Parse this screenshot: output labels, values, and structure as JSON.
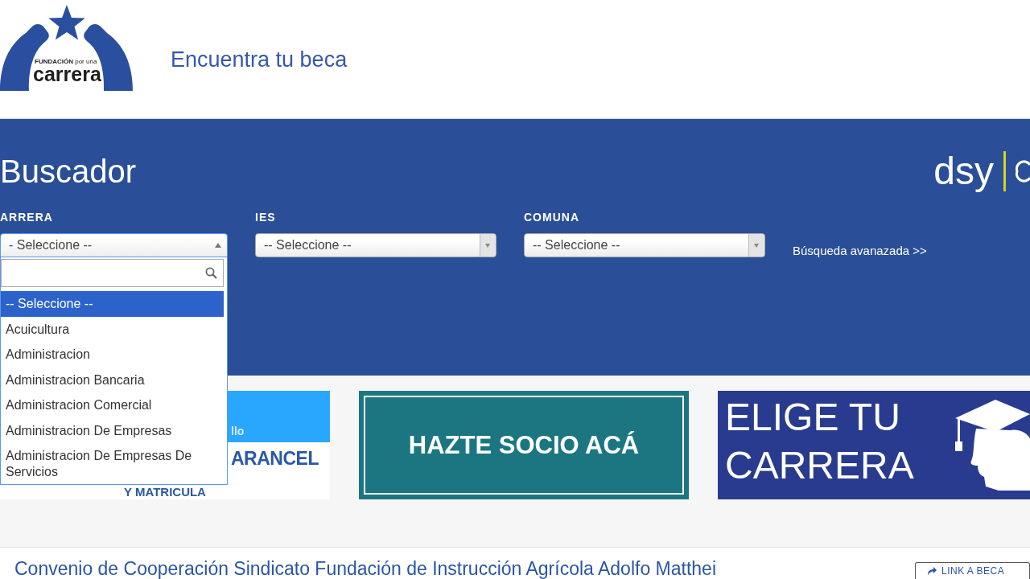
{
  "header": {
    "logo": {
      "tagline": "**FUNDACIÓN** por una",
      "name": "carrera"
    },
    "title": "Encuentra tu beca"
  },
  "search_panel": {
    "title": "Buscador",
    "partner_logo": "dsy",
    "filters": [
      {
        "label": "ARRERA",
        "value": "- Seleccione --",
        "expanded": true,
        "options": [
          {
            "label": "-- Seleccione --",
            "selected": true
          },
          {
            "label": "Acuicultura",
            "selected": false
          },
          {
            "label": "Administracion",
            "selected": false
          },
          {
            "label": "Administracion Bancaria",
            "selected": false
          },
          {
            "label": "Administracion Comercial",
            "selected": false
          },
          {
            "label": "Administracion De Empresas",
            "selected": false
          },
          {
            "label": "Administracion De Empresas De Servicios",
            "selected": false
          }
        ]
      },
      {
        "label": "IES",
        "value": "-- Seleccione --",
        "expanded": false
      },
      {
        "label": "COMUNA",
        "value": "-- Seleccione --",
        "expanded": false
      }
    ],
    "advanced_link": "Búsqueda avanazada >>"
  },
  "banners": [
    {
      "kind": "fee",
      "lines": [
        "llo",
        "ARANCEL",
        "Y MATRICULA"
      ]
    },
    {
      "kind": "join",
      "lines": [
        "HAZTE SOCIO ACÁ"
      ]
    },
    {
      "kind": "career",
      "lines": [
        "ELIGE TU",
        "CARRERA"
      ]
    }
  ],
  "scholarship": {
    "title": "Convenio de Cooperación Sindicato Fundación de Instrucción Agrícola Adolfo Matthei",
    "button": "LINK A BECA"
  }
}
